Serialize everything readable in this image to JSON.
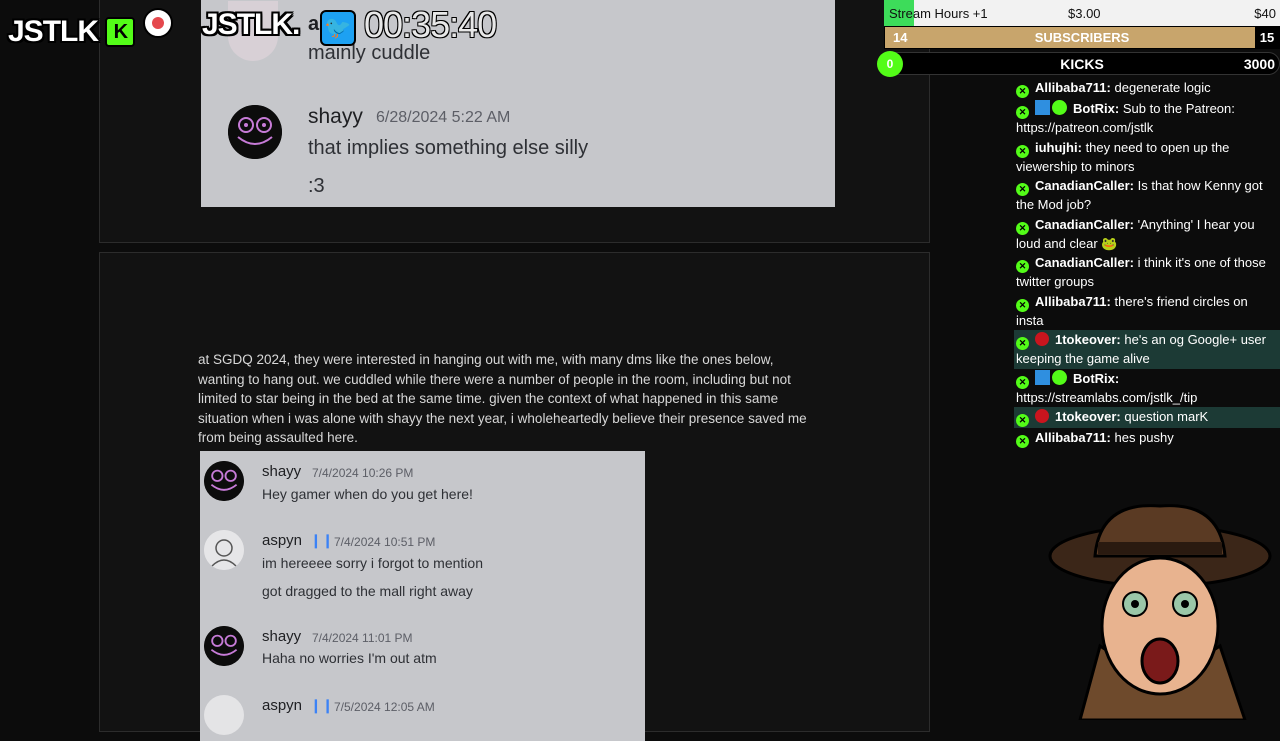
{
  "overlay": {
    "logo_left": "JSTLK",
    "logo_right": "JSTLK.",
    "timer": "00:35:40"
  },
  "stream_bars": {
    "hours_label": "Stream Hours +1",
    "hours_value": "$3.00",
    "hours_goal": "$40",
    "hours_progress": 0.075,
    "subs_left": "14",
    "subs_label": "SUBSCRIBERS",
    "subs_right": "15",
    "kicks_left": "0",
    "kicks_label": "KICKS",
    "kicks_right": "3000"
  },
  "doc": {
    "top_shot": {
      "partial_name": "a",
      "partial_text": "mainly cuddle",
      "msg_name": "shayy",
      "msg_time": "6/28/2024 5:22 AM",
      "msg_line1": "that implies something else silly",
      "msg_line2": ":3"
    },
    "paragraph": "at SGDQ 2024, they were interested in hanging out with me, with many dms like the ones below, wanting to hang out. we cuddled while there were a number of people in the room, including but not limited to star being in the bed at the same time. given the context of what happened in this same situation when i was alone with shayy the next year, i wholeheartedly believe their presence saved me from being assaulted here.",
    "messages": [
      {
        "name": "shayy",
        "time": "7/4/2024 10:26 PM",
        "lines": [
          "Hey gamer when do you get here!"
        ]
      },
      {
        "name": "aspyn",
        "time": "7/4/2024 10:51 PM",
        "lines": [
          "im hereeee sorry i forgot to mention",
          "got dragged to the mall right away"
        ]
      },
      {
        "name": "shayy",
        "time": "7/4/2024 11:01 PM",
        "lines": [
          "Haha no worries I'm out atm"
        ]
      },
      {
        "name": "aspyn",
        "time": "7/5/2024 12:05 AM",
        "lines": []
      }
    ]
  },
  "chat": [
    {
      "name": "Allibaba711:",
      "text": "degenerate logic",
      "badges": [
        "kick"
      ],
      "hl": false
    },
    {
      "name": "BotRix:",
      "text": "Sub to the Patreon: https://patreon.com/jstlk",
      "badges": [
        "kick",
        "bot",
        "verified"
      ],
      "hl": false
    },
    {
      "name": "iuhujhi:",
      "text": "they need to open up the viewership to minors",
      "badges": [
        "kick"
      ],
      "hl": false
    },
    {
      "name": "CanadianCaller:",
      "text": "Is that how Kenny got the Mod job?",
      "badges": [
        "kick"
      ],
      "hl": false
    },
    {
      "name": "CanadianCaller:",
      "text": "'Anything' I hear you loud and clear 🐸",
      "badges": [
        "kick"
      ],
      "hl": false
    },
    {
      "name": "CanadianCaller:",
      "text": "i think it's one of those twitter groups",
      "badges": [
        "kick"
      ],
      "hl": false
    },
    {
      "name": "Allibaba711:",
      "text": "there's friend circles on insta",
      "badges": [
        "kick"
      ],
      "hl": false
    },
    {
      "name": "1tokeover:",
      "text": "he's an og Google+ user keeping the game alive",
      "badges": [
        "kick",
        "red"
      ],
      "hl": true
    },
    {
      "name": "BotRix:",
      "text": "https://streamlabs.com/jstlk_/tip",
      "badges": [
        "kick",
        "bot",
        "verified"
      ],
      "hl": false
    },
    {
      "name": "1tokeover:",
      "text": "question marK",
      "badges": [
        "kick",
        "red"
      ],
      "hl": true
    },
    {
      "name": "Allibaba711:",
      "text": "hes pushy",
      "badges": [
        "kick"
      ],
      "hl": false
    }
  ],
  "colors": {
    "kick_green": "#53fc18",
    "subs_gold": "#c8a56c",
    "discord_bg": "#c6c7cb"
  }
}
